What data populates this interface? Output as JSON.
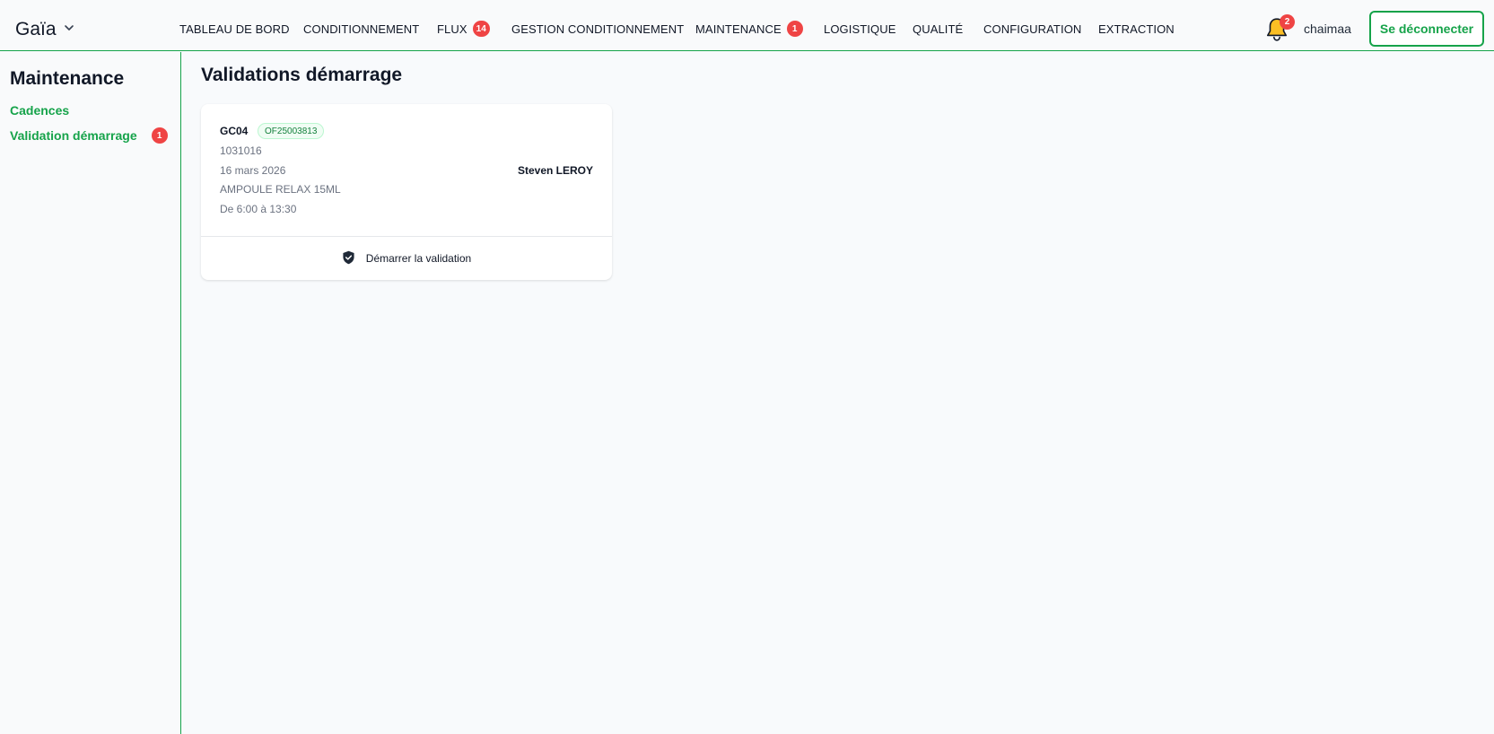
{
  "app": {
    "brand": "Gaïa"
  },
  "nav": {
    "items": [
      {
        "label": "TABLEAU DE BORD"
      },
      {
        "label": "CONDITIONNEMENT"
      },
      {
        "label": "FLUX",
        "badge": "14"
      },
      {
        "label": "GESTION CONDITIONNEMENT"
      },
      {
        "label": "MAINTENANCE",
        "badge": "1"
      },
      {
        "label": "LOGISTIQUE"
      },
      {
        "label": "QUALITÉ"
      },
      {
        "label": "CONFIGURATION"
      },
      {
        "label": "EXTRACTION"
      }
    ]
  },
  "header": {
    "notifications_count": "2",
    "username": "chaimaa",
    "logout_label": "Se déconnecter"
  },
  "sidebar": {
    "title": "Maintenance",
    "items": [
      {
        "label": "Cadences"
      },
      {
        "label": "Validation démarrage",
        "badge": "1"
      }
    ]
  },
  "main": {
    "title": "Validations démarrage",
    "card": {
      "machine": "GC04",
      "of_number": "OF25003813",
      "code": "1031016",
      "date": "16 mars 2026",
      "product": "AMPOULE RELAX 15ML",
      "schedule": "De 6:00 à 13:30",
      "operator": "Steven LEROY",
      "action_label": "Démarrer la validation"
    }
  },
  "colors": {
    "accent": "#16a34a",
    "badge": "#ef4444",
    "bell": "#fbbf24"
  }
}
